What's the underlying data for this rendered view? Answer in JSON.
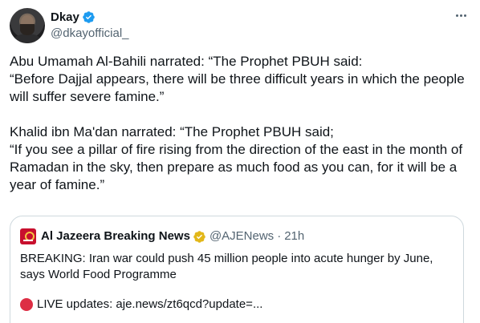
{
  "author": {
    "display_name": "Dkay",
    "handle": "@dkayofficial_",
    "verified": true
  },
  "tweet": {
    "text": "Abu Umamah Al-Bahili narrated: “The Prophet PBUH said:\n“Before Dajjal appears, there will be three difficult years in which the people will suffer severe famine.”\n\nKhalid ibn Ma'dan narrated: “The Prophet PBUH said;\n“If you see a pillar of fire rising from the direction of the east in the month of Ramadan in the sky, then prepare as much food as you can, for it will be a year of famine.”"
  },
  "quoted_tweet": {
    "display_name": "Al Jazeera Breaking News",
    "handle": "@AJENews",
    "separator": "·",
    "time": "21h",
    "text": "BREAKING: Iran war could push 45 million people into acute hunger by June, says World Food Programme",
    "live_text": "LIVE updates: aje.news/zt6qcd?update=..."
  },
  "icons": {
    "verified": "blue-check-icon",
    "org_verified": "gold-check-icon",
    "more": "more-options-icon",
    "live": "red-circle-icon"
  },
  "colors": {
    "verified_blue": "#1d9bf0",
    "org_gold": "#e2b719",
    "secondary_text": "#536471",
    "live_red": "#dd2e44"
  }
}
